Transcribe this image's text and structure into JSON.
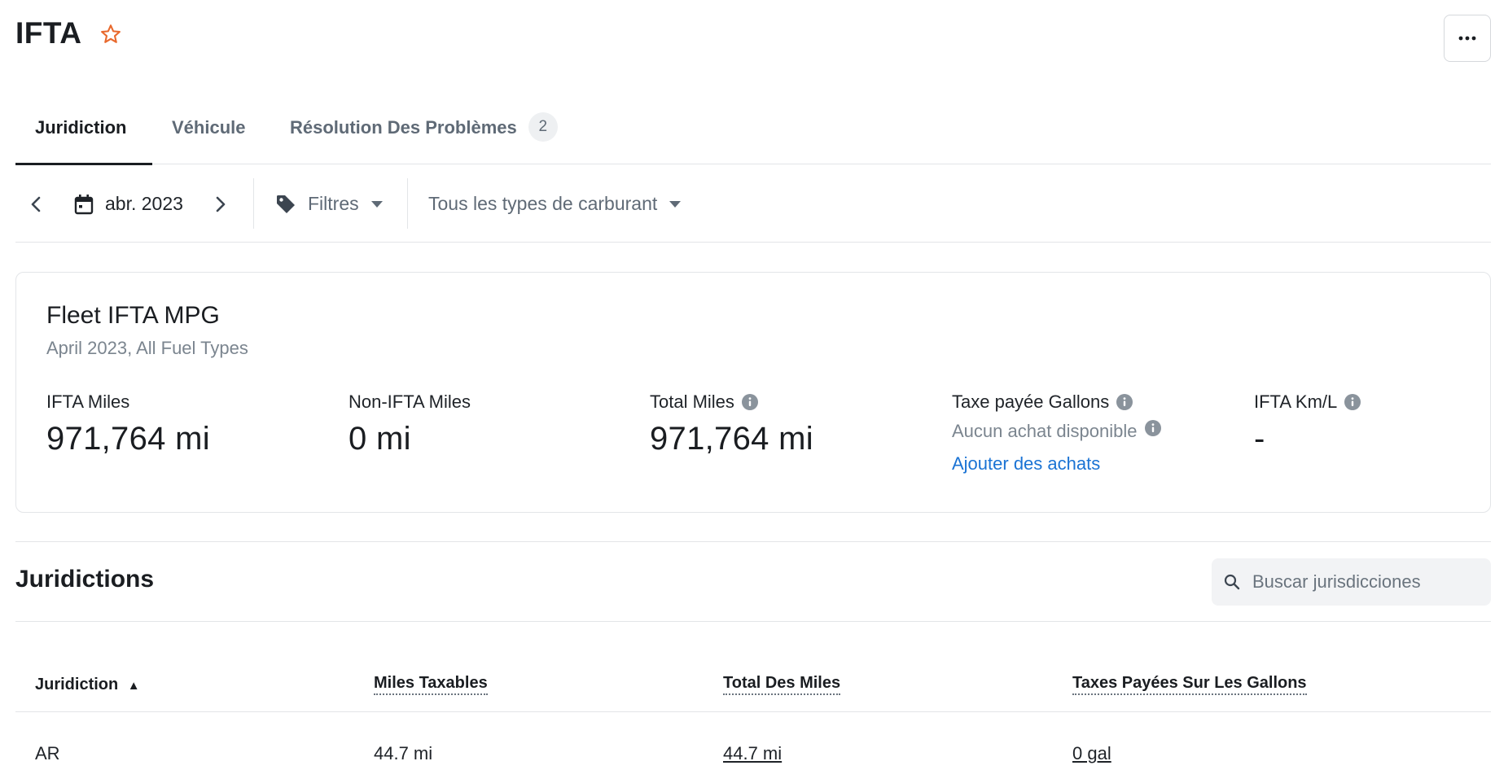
{
  "header": {
    "title": "IFTA",
    "favorite_icon": "star-outline-icon",
    "more_icon": "ellipsis-icon"
  },
  "tabs": [
    {
      "label": "Juridiction",
      "active": true
    },
    {
      "label": "Véhicule",
      "active": false
    },
    {
      "label": "Résolution Des Problèmes",
      "active": false,
      "badge": "2"
    }
  ],
  "toolbar": {
    "date": "abr. 2023",
    "filters_label": "Filtres",
    "fuel_type_label": "Tous les types de carburant"
  },
  "summary": {
    "title": "Fleet IFTA MPG",
    "subtitle": "April 2023, All Fuel Types",
    "ifta_miles": {
      "label": "IFTA Miles",
      "value": "971,764 mi"
    },
    "non_ifta_miles": {
      "label": "Non-IFTA Miles",
      "value": "0 mi"
    },
    "total_miles": {
      "label": "Total Miles",
      "value": "971,764 mi"
    },
    "tax_paid_gallons": {
      "label": "Taxe payée Gallons",
      "empty_text": "Aucun achat disponible",
      "link": "Ajouter des achats"
    },
    "ifta_kml": {
      "label": "IFTA Km/L",
      "value": "-"
    }
  },
  "jurisdictions": {
    "title": "Juridictions",
    "search_placeholder": "Buscar jurisdicciones",
    "columns": [
      "Juridiction",
      "Miles Taxables",
      "Total Des Miles",
      "Taxes Payées Sur Les Gallons"
    ],
    "sort_indicator": "▲",
    "rows": [
      {
        "jurisdiction": "AR",
        "taxable_miles": "44.7 mi",
        "total_miles": "44.7 mi",
        "tax_paid_gallons": "0 gal"
      }
    ]
  },
  "colors": {
    "accent_star": "#e8692d",
    "link": "#1a73d4",
    "muted": "#7b858f"
  }
}
